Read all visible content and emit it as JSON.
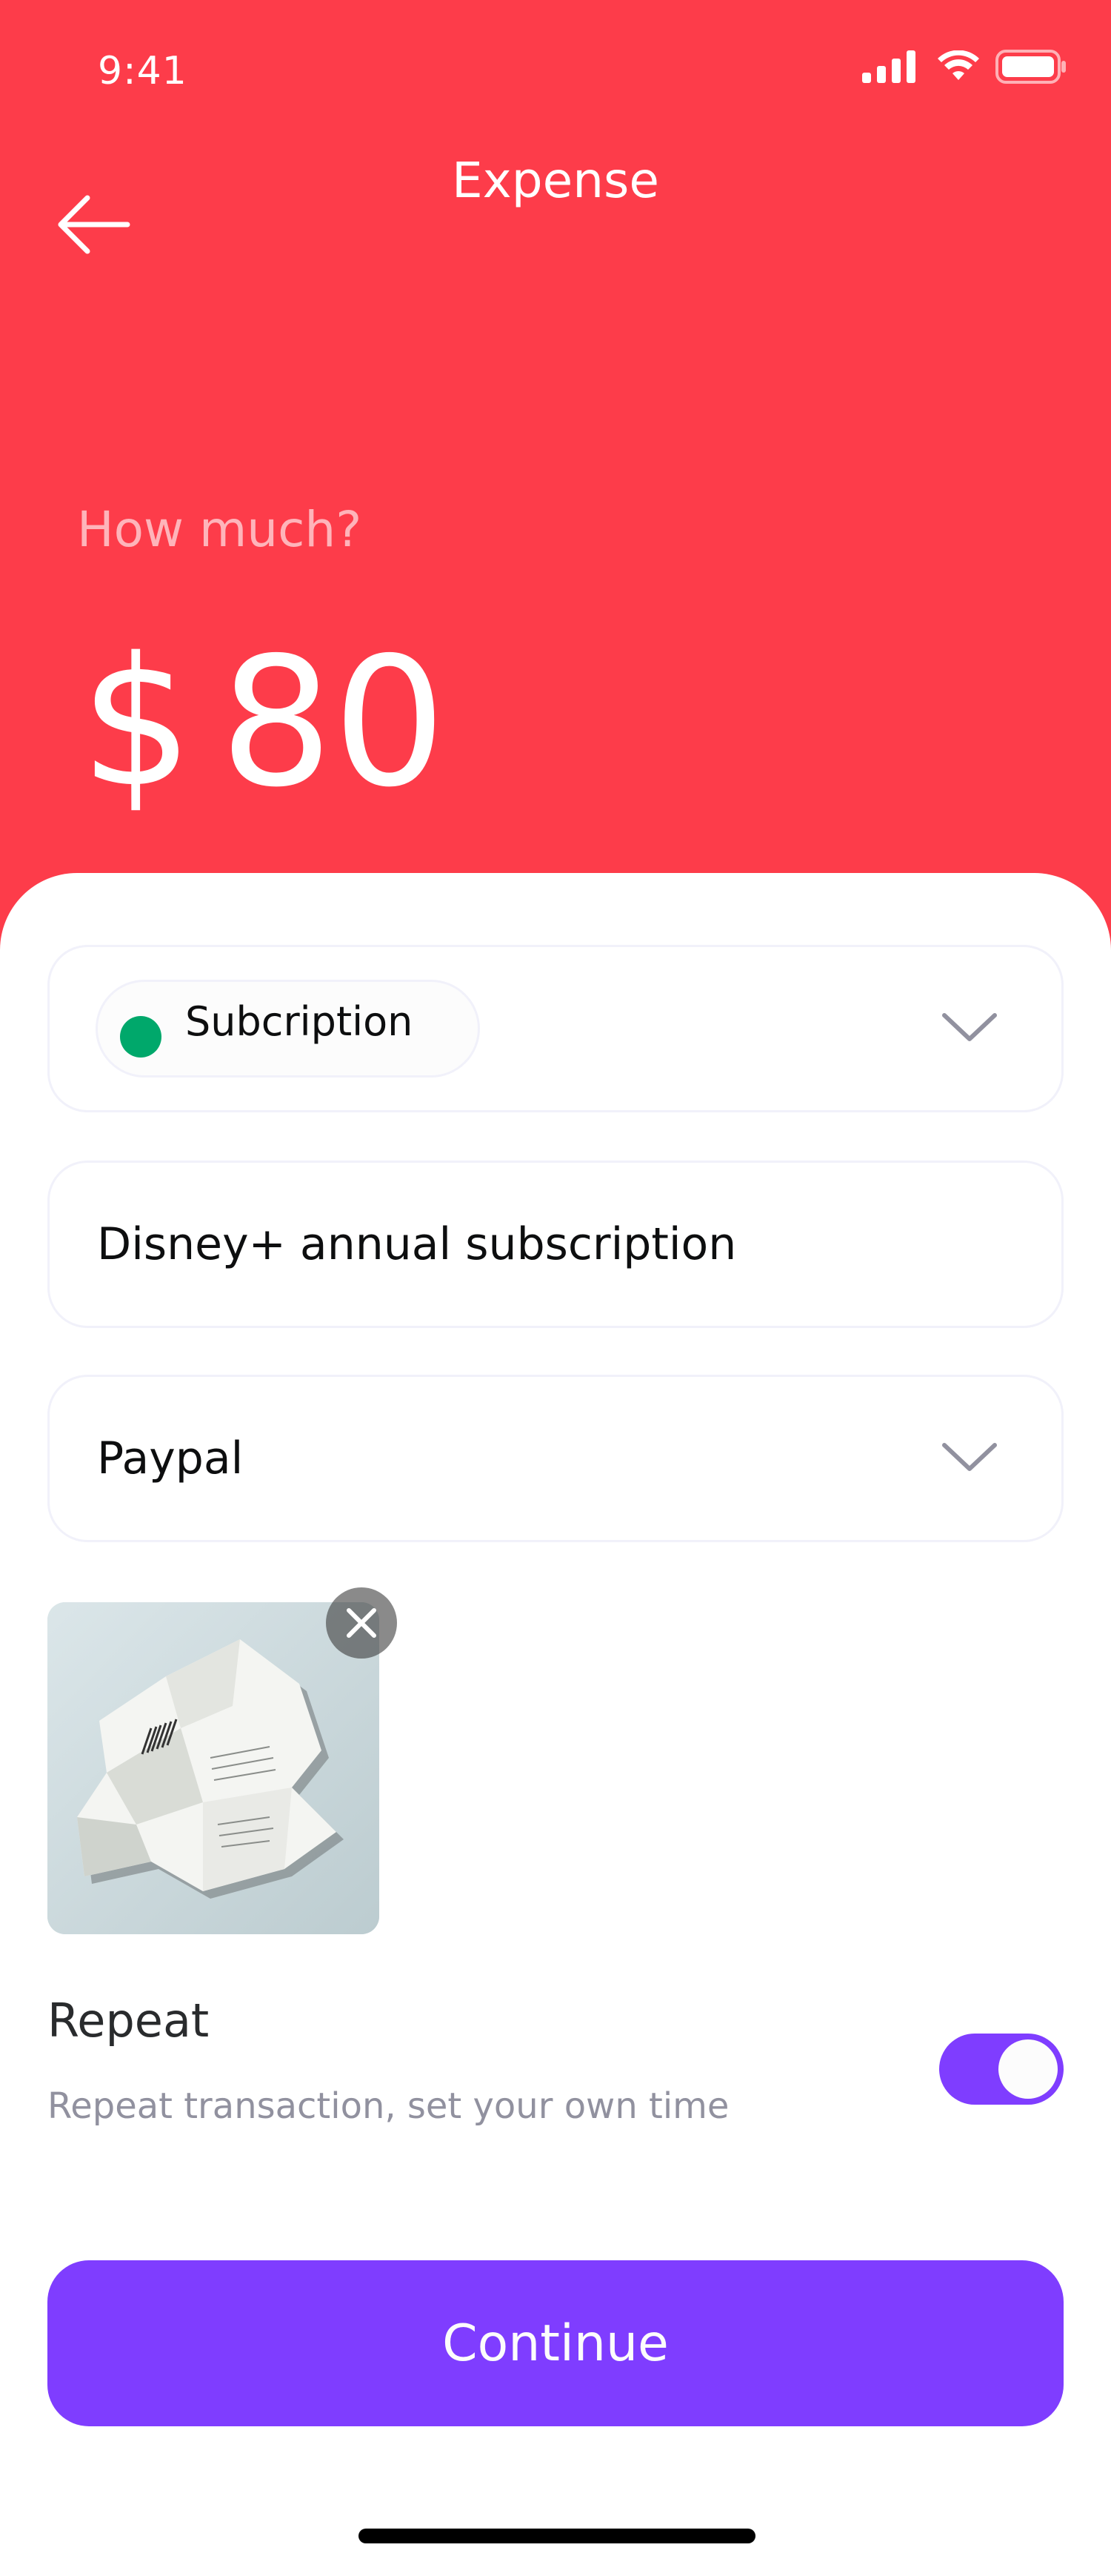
{
  "status_bar": {
    "time": "9:41",
    "icons": [
      "cellular-signal-icon",
      "wifi-icon",
      "battery-icon"
    ]
  },
  "header": {
    "title": "Expense",
    "back_icon": "arrow-left-icon"
  },
  "amount": {
    "prompt": "How much?",
    "currency": "$",
    "value": "80"
  },
  "form": {
    "category": {
      "label": "Subcription",
      "dot_color": "#00a86b",
      "chevron_icon": "chevron-down-icon"
    },
    "description": {
      "value": "Disney+ annual subscription"
    },
    "wallet": {
      "value": "Paypal",
      "chevron_icon": "chevron-down-icon"
    },
    "attachment": {
      "type": "receipt-photo",
      "remove_icon": "close-icon"
    }
  },
  "repeat": {
    "title": "Repeat",
    "subtitle": "Repeat transaction, set your own time",
    "enabled": true
  },
  "continue_label": "Continue",
  "colors": {
    "expense_red": "#fd3c4a",
    "primary_violet": "#7f3dff",
    "category_green": "#00a86b"
  }
}
